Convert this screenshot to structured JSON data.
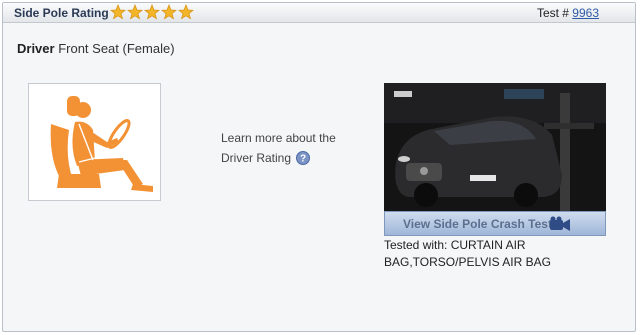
{
  "header": {
    "title": "Side Pole Rating",
    "star_rating": 5,
    "star_max": 5,
    "star_color": "#f2b628",
    "test_label": "Test #",
    "test_number": "9963"
  },
  "seat": {
    "position_strong": "Driver",
    "position_rest": "Front Seat (Female)",
    "icon": "seated-occupant-icon",
    "icon_color": "#f39234"
  },
  "learn_more": {
    "line1": "Learn more about the",
    "line2": "Driver Rating",
    "help_icon": "help-icon"
  },
  "video": {
    "button_label": "View Side Pole Crash Test",
    "button_icon": "video-camera-icon"
  },
  "tested_with": "Tested with: CURTAIN AIR BAG,TORSO/PELVIS AIR BAG"
}
